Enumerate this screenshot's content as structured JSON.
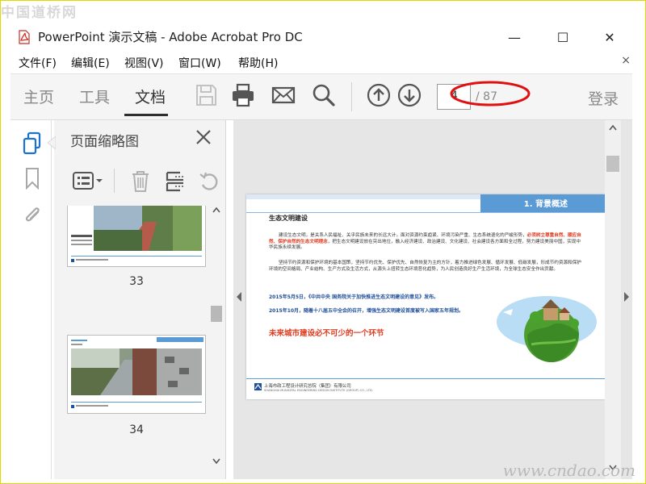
{
  "watermark": {
    "top": "中国道桥网",
    "bottom": "www.cndao.com"
  },
  "window": {
    "title": "PowerPoint 演示文稿 - Adobe Acrobat Pro DC",
    "minimize": "—",
    "maximize": "☐",
    "close": "✕"
  },
  "menu": {
    "items": [
      "文件(F)",
      "编辑(E)",
      "视图(V)",
      "窗口(W)",
      "帮助(H)"
    ],
    "close": "×"
  },
  "toolbar": {
    "tabs": [
      "主页",
      "工具",
      "文档"
    ],
    "active_tab": "文档",
    "page_current": "4",
    "page_total": "/ 87",
    "login": "登录"
  },
  "thumbnail_panel": {
    "title": "页面缩略图",
    "thumbnails": [
      {
        "page": "33"
      },
      {
        "page": "34",
        "header_tag": "2. 设计标准"
      }
    ]
  },
  "document": {
    "header_tag": "1. 背景概述",
    "heading": "生态文明建设",
    "para1_start": "建设生态文明，是关系人民福祉、关乎民族未来的长远大计。面对资源约束趋紧、环境污染严重、生态系统退化的严峻形势，",
    "para1_red": "必须树立尊重自然、顺应自然、保护自然的生态文明理念",
    "para1_end": "，把生态文明建设放在突出地位，融入经济建设、政治建设、文化建设、社会建设各方面和全过程，努力建设美丽中国，实现中华民族永续发展。",
    "para2": "坚持节约资源和保护环境的基本国策，坚持节约优先、保护优先、自然恢复为主的方针，着力推进绿色发展、循环发展、低碳发展，形成节约资源和保护环境的空间格局、产业结构、生产方式及生活方式，从源头上扭转生态环境恶化趋势，为人民创造良好生产生活环境，为全球生态安全作出贡献。",
    "bullet1": "2015年5月5日，《中共中央 国务院关于加快推进生态文明建设的意见》发布。",
    "bullet2": "2015年10月，随着十八届五中全会的召开，增强生态文明建设首度被写入国家五年规划。",
    "highlight": "未来城市建设必不可少的一个环节",
    "footer_cn": "上海市政工程设计研究总院（集团）有限公司",
    "footer_en": "SHANGHAI MUNICIPAL ENGINEERING DESIGN INSTITUTE (GROUP) CO., LTD."
  },
  "colors": {
    "accent_blue": "#5b9bd5",
    "text_red": "#e03a1e",
    "text_blue": "#1f4e9a",
    "annotation_red": "#e01010"
  }
}
